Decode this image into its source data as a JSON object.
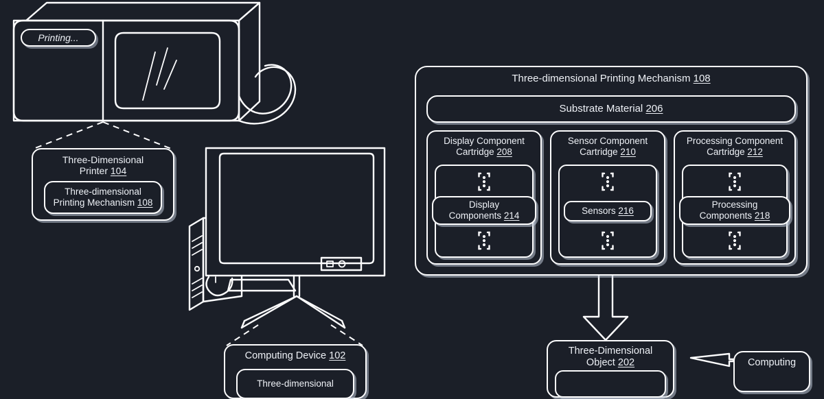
{
  "figure": {
    "background_color": "#1b1f28",
    "line_color": "#fdfdfe",
    "shadow_color": "#bec6d6"
  },
  "printer_illustration": {
    "status_pill": "Printing...",
    "icon": "three-dimensional-printer"
  },
  "computer_illustration": {
    "icon": "desktop-computer-monitor-tower"
  },
  "callouts": {
    "printer": {
      "title_line1": "Three-Dimensional",
      "title_line2_text": "Printer",
      "title_line2_num": "104",
      "inner": {
        "line1": "Three-dimensional",
        "line2_text": "Printing Mechanism",
        "line2_num": "108"
      }
    },
    "computing_device": {
      "title_text": "Computing Device",
      "title_num": "102",
      "inner": {
        "line1": "Three-dimensional"
      }
    }
  },
  "mechanism_panel": {
    "title_text": "Three-dimensional Printing Mechanism",
    "title_num": "108",
    "substrate": {
      "label_text": "Substrate Material",
      "label_num": "206"
    },
    "cartridges": [
      {
        "title_line1": "Display Component",
        "title_line2_text": "Cartridge",
        "title_line2_num": "208",
        "inner_line1": "Display",
        "inner_line2_text": "Components",
        "inner_line2_num": "214",
        "icon_top": "vertical-ellipsis-bracket-icon",
        "icon_bottom": "vertical-ellipsis-bracket-icon"
      },
      {
        "title_line1": "Sensor Component",
        "title_line2_text": "Cartridge",
        "title_line2_num": "210",
        "inner_line1": "",
        "inner_line2_text": "Sensors",
        "inner_line2_num": "216",
        "icon_top": "vertical-ellipsis-bracket-icon",
        "icon_bottom": "vertical-ellipsis-bracket-icon"
      },
      {
        "title_line1": "Processing Component",
        "title_line2_text": "Cartridge",
        "title_line2_num": "212",
        "inner_line1": "Processing",
        "inner_line2_text": "Components",
        "inner_line2_num": "218",
        "icon_top": "vertical-ellipsis-bracket-icon",
        "icon_bottom": "vertical-ellipsis-bracket-icon"
      }
    ]
  },
  "output": {
    "object_box": {
      "title_line1": "Three-Dimensional",
      "title_line2_text": "Object",
      "title_line2_num": "202"
    },
    "computing_box": {
      "title_line1": "Computing"
    },
    "down_arrow": "down-arrow",
    "left_arrow": "left-arrow"
  }
}
